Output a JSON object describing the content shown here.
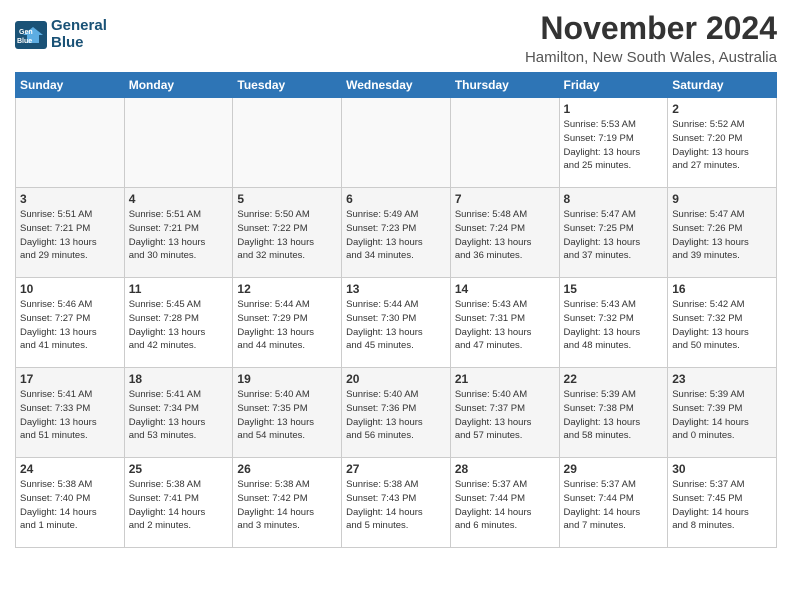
{
  "logo": {
    "line1": "General",
    "line2": "Blue"
  },
  "title": "November 2024",
  "location": "Hamilton, New South Wales, Australia",
  "days_of_week": [
    "Sunday",
    "Monday",
    "Tuesday",
    "Wednesday",
    "Thursday",
    "Friday",
    "Saturday"
  ],
  "weeks": [
    [
      {
        "day": "",
        "info": ""
      },
      {
        "day": "",
        "info": ""
      },
      {
        "day": "",
        "info": ""
      },
      {
        "day": "",
        "info": ""
      },
      {
        "day": "",
        "info": ""
      },
      {
        "day": "1",
        "info": "Sunrise: 5:53 AM\nSunset: 7:19 PM\nDaylight: 13 hours\nand 25 minutes."
      },
      {
        "day": "2",
        "info": "Sunrise: 5:52 AM\nSunset: 7:20 PM\nDaylight: 13 hours\nand 27 minutes."
      }
    ],
    [
      {
        "day": "3",
        "info": "Sunrise: 5:51 AM\nSunset: 7:21 PM\nDaylight: 13 hours\nand 29 minutes."
      },
      {
        "day": "4",
        "info": "Sunrise: 5:51 AM\nSunset: 7:21 PM\nDaylight: 13 hours\nand 30 minutes."
      },
      {
        "day": "5",
        "info": "Sunrise: 5:50 AM\nSunset: 7:22 PM\nDaylight: 13 hours\nand 32 minutes."
      },
      {
        "day": "6",
        "info": "Sunrise: 5:49 AM\nSunset: 7:23 PM\nDaylight: 13 hours\nand 34 minutes."
      },
      {
        "day": "7",
        "info": "Sunrise: 5:48 AM\nSunset: 7:24 PM\nDaylight: 13 hours\nand 36 minutes."
      },
      {
        "day": "8",
        "info": "Sunrise: 5:47 AM\nSunset: 7:25 PM\nDaylight: 13 hours\nand 37 minutes."
      },
      {
        "day": "9",
        "info": "Sunrise: 5:47 AM\nSunset: 7:26 PM\nDaylight: 13 hours\nand 39 minutes."
      }
    ],
    [
      {
        "day": "10",
        "info": "Sunrise: 5:46 AM\nSunset: 7:27 PM\nDaylight: 13 hours\nand 41 minutes."
      },
      {
        "day": "11",
        "info": "Sunrise: 5:45 AM\nSunset: 7:28 PM\nDaylight: 13 hours\nand 42 minutes."
      },
      {
        "day": "12",
        "info": "Sunrise: 5:44 AM\nSunset: 7:29 PM\nDaylight: 13 hours\nand 44 minutes."
      },
      {
        "day": "13",
        "info": "Sunrise: 5:44 AM\nSunset: 7:30 PM\nDaylight: 13 hours\nand 45 minutes."
      },
      {
        "day": "14",
        "info": "Sunrise: 5:43 AM\nSunset: 7:31 PM\nDaylight: 13 hours\nand 47 minutes."
      },
      {
        "day": "15",
        "info": "Sunrise: 5:43 AM\nSunset: 7:32 PM\nDaylight: 13 hours\nand 48 minutes."
      },
      {
        "day": "16",
        "info": "Sunrise: 5:42 AM\nSunset: 7:32 PM\nDaylight: 13 hours\nand 50 minutes."
      }
    ],
    [
      {
        "day": "17",
        "info": "Sunrise: 5:41 AM\nSunset: 7:33 PM\nDaylight: 13 hours\nand 51 minutes."
      },
      {
        "day": "18",
        "info": "Sunrise: 5:41 AM\nSunset: 7:34 PM\nDaylight: 13 hours\nand 53 minutes."
      },
      {
        "day": "19",
        "info": "Sunrise: 5:40 AM\nSunset: 7:35 PM\nDaylight: 13 hours\nand 54 minutes."
      },
      {
        "day": "20",
        "info": "Sunrise: 5:40 AM\nSunset: 7:36 PM\nDaylight: 13 hours\nand 56 minutes."
      },
      {
        "day": "21",
        "info": "Sunrise: 5:40 AM\nSunset: 7:37 PM\nDaylight: 13 hours\nand 57 minutes."
      },
      {
        "day": "22",
        "info": "Sunrise: 5:39 AM\nSunset: 7:38 PM\nDaylight: 13 hours\nand 58 minutes."
      },
      {
        "day": "23",
        "info": "Sunrise: 5:39 AM\nSunset: 7:39 PM\nDaylight: 14 hours\nand 0 minutes."
      }
    ],
    [
      {
        "day": "24",
        "info": "Sunrise: 5:38 AM\nSunset: 7:40 PM\nDaylight: 14 hours\nand 1 minute."
      },
      {
        "day": "25",
        "info": "Sunrise: 5:38 AM\nSunset: 7:41 PM\nDaylight: 14 hours\nand 2 minutes."
      },
      {
        "day": "26",
        "info": "Sunrise: 5:38 AM\nSunset: 7:42 PM\nDaylight: 14 hours\nand 3 minutes."
      },
      {
        "day": "27",
        "info": "Sunrise: 5:38 AM\nSunset: 7:43 PM\nDaylight: 14 hours\nand 5 minutes."
      },
      {
        "day": "28",
        "info": "Sunrise: 5:37 AM\nSunset: 7:44 PM\nDaylight: 14 hours\nand 6 minutes."
      },
      {
        "day": "29",
        "info": "Sunrise: 5:37 AM\nSunset: 7:44 PM\nDaylight: 14 hours\nand 7 minutes."
      },
      {
        "day": "30",
        "info": "Sunrise: 5:37 AM\nSunset: 7:45 PM\nDaylight: 14 hours\nand 8 minutes."
      }
    ]
  ]
}
